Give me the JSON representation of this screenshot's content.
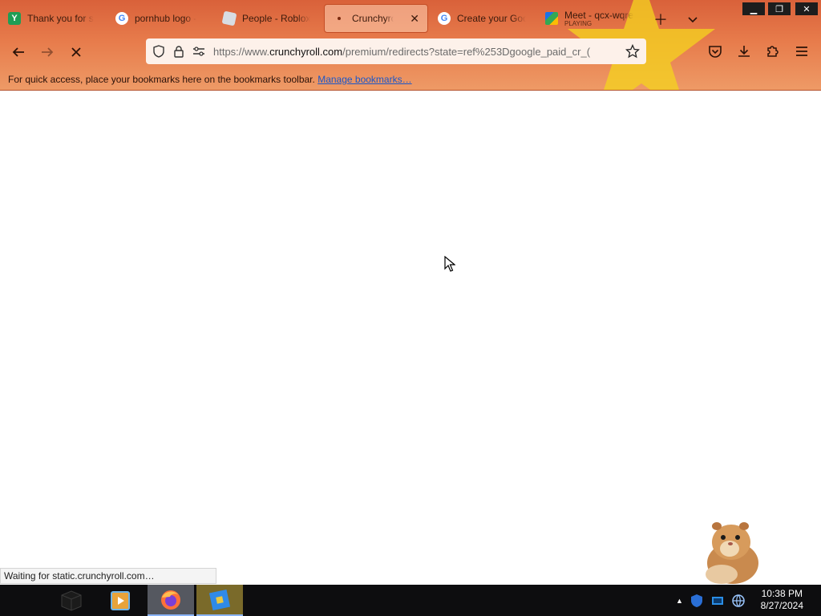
{
  "tabs": [
    {
      "title": "Thank you for s",
      "icon": "green-y-icon",
      "active": false
    },
    {
      "title": "pornhub logo -",
      "icon": "google-icon",
      "active": false
    },
    {
      "title": "People - Roblox",
      "icon": "roblox-icon",
      "active": false
    },
    {
      "title": "Crunchyroll",
      "icon": "loading-dot-icon",
      "active": true
    },
    {
      "title": "Create your Goo",
      "icon": "google-icon",
      "active": false
    },
    {
      "title": "Meet - qcx-wqre",
      "subtitle": "PLAYING",
      "icon": "google-meet-icon",
      "active": false
    }
  ],
  "urlbar": {
    "prefix": "https://www.",
    "host": "crunchyroll.com",
    "path": "/premium/redirects?state=ref%253Dgoogle_paid_cr_("
  },
  "bookmarks_bar": {
    "message": "For quick access, place your bookmarks here on the bookmarks toolbar.",
    "link": "Manage bookmarks…"
  },
  "status": {
    "text": "Waiting for static.crunchyroll.com…"
  },
  "taskbar": {
    "clock_time": "10:38 PM",
    "clock_date": "8/27/2024"
  },
  "colors": {
    "theme": "#e77b4b",
    "star": "#f5d21e",
    "taskbar": "#0d0d0f"
  }
}
